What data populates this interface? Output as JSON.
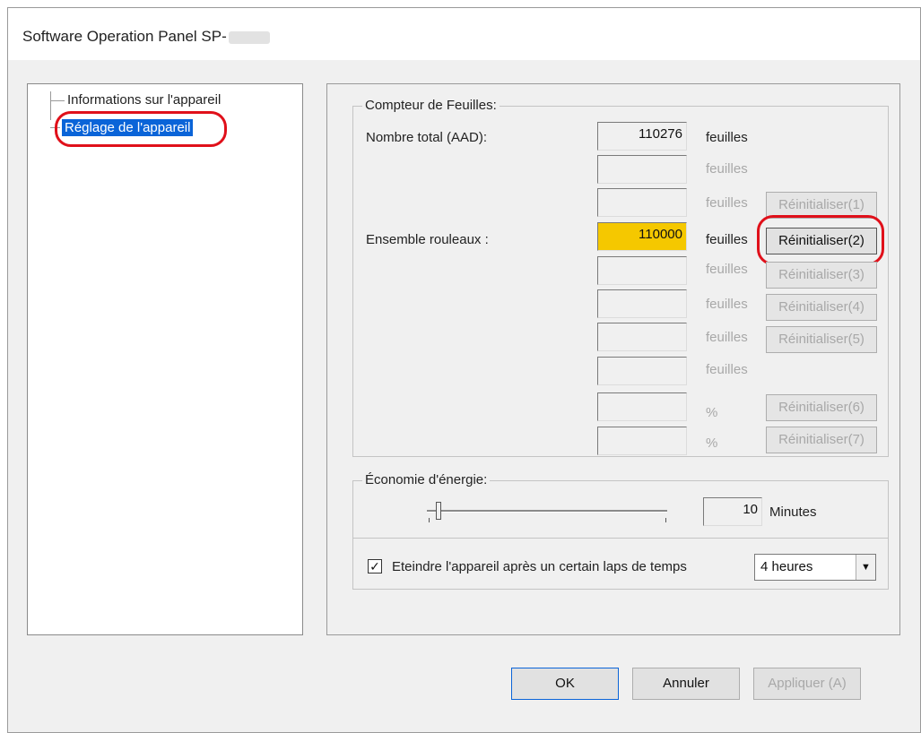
{
  "window": {
    "title": "Software Operation Panel SP-"
  },
  "tree": {
    "items": [
      {
        "label": "Informations sur l'appareil",
        "selected": false
      },
      {
        "label": "Réglage de l'appareil",
        "selected": true
      }
    ]
  },
  "sheet_counter": {
    "group_label": "Compteur de Feuilles:",
    "total_label": "Nombre total (AAD):",
    "rollers_label": "Ensemble rouleaux :",
    "rows": [
      {
        "value": "110276",
        "unit": "feuilles",
        "unit_enabled": true,
        "button": null
      },
      {
        "value": "",
        "unit": "feuilles",
        "unit_enabled": false,
        "button": null
      },
      {
        "value": "",
        "unit": "feuilles",
        "unit_enabled": false,
        "button": "Réinitialiser(1)",
        "button_enabled": false
      },
      {
        "value": "110000",
        "unit": "feuilles",
        "unit_enabled": true,
        "button": "Réinitialiser(2)",
        "button_enabled": true,
        "highlight": true
      },
      {
        "value": "",
        "unit": "feuilles",
        "unit_enabled": false,
        "button": "Réinitialiser(3)",
        "button_enabled": false
      },
      {
        "value": "",
        "unit": "feuilles",
        "unit_enabled": false,
        "button": "Réinitialiser(4)",
        "button_enabled": false
      },
      {
        "value": "",
        "unit": "feuilles",
        "unit_enabled": false,
        "button": "Réinitialiser(5)",
        "button_enabled": false
      },
      {
        "value": "",
        "unit": "feuilles",
        "unit_enabled": false,
        "button": null
      },
      {
        "value": "",
        "unit": "%",
        "unit_enabled": false,
        "button": "Réinitialiser(6)",
        "button_enabled": false
      },
      {
        "value": "",
        "unit": "%",
        "unit_enabled": false,
        "button": "Réinitialiser(7)",
        "button_enabled": false
      }
    ]
  },
  "energy": {
    "group_label": "Économie d'énergie:",
    "minutes_value": "10",
    "minutes_unit": "Minutes",
    "auto_off_label": "Eteindre l'appareil après un certain laps de temps",
    "auto_off_checked": true,
    "checkbox_mark": "✓",
    "auto_off_selected": "4 heures",
    "select_arrow": "▼"
  },
  "buttons": {
    "ok": "OK",
    "cancel": "Annuler",
    "apply": "Appliquer (A)"
  },
  "colors": {
    "highlight": "#f5c800",
    "selection": "#0a64d8",
    "annotation": "#e0101a"
  }
}
